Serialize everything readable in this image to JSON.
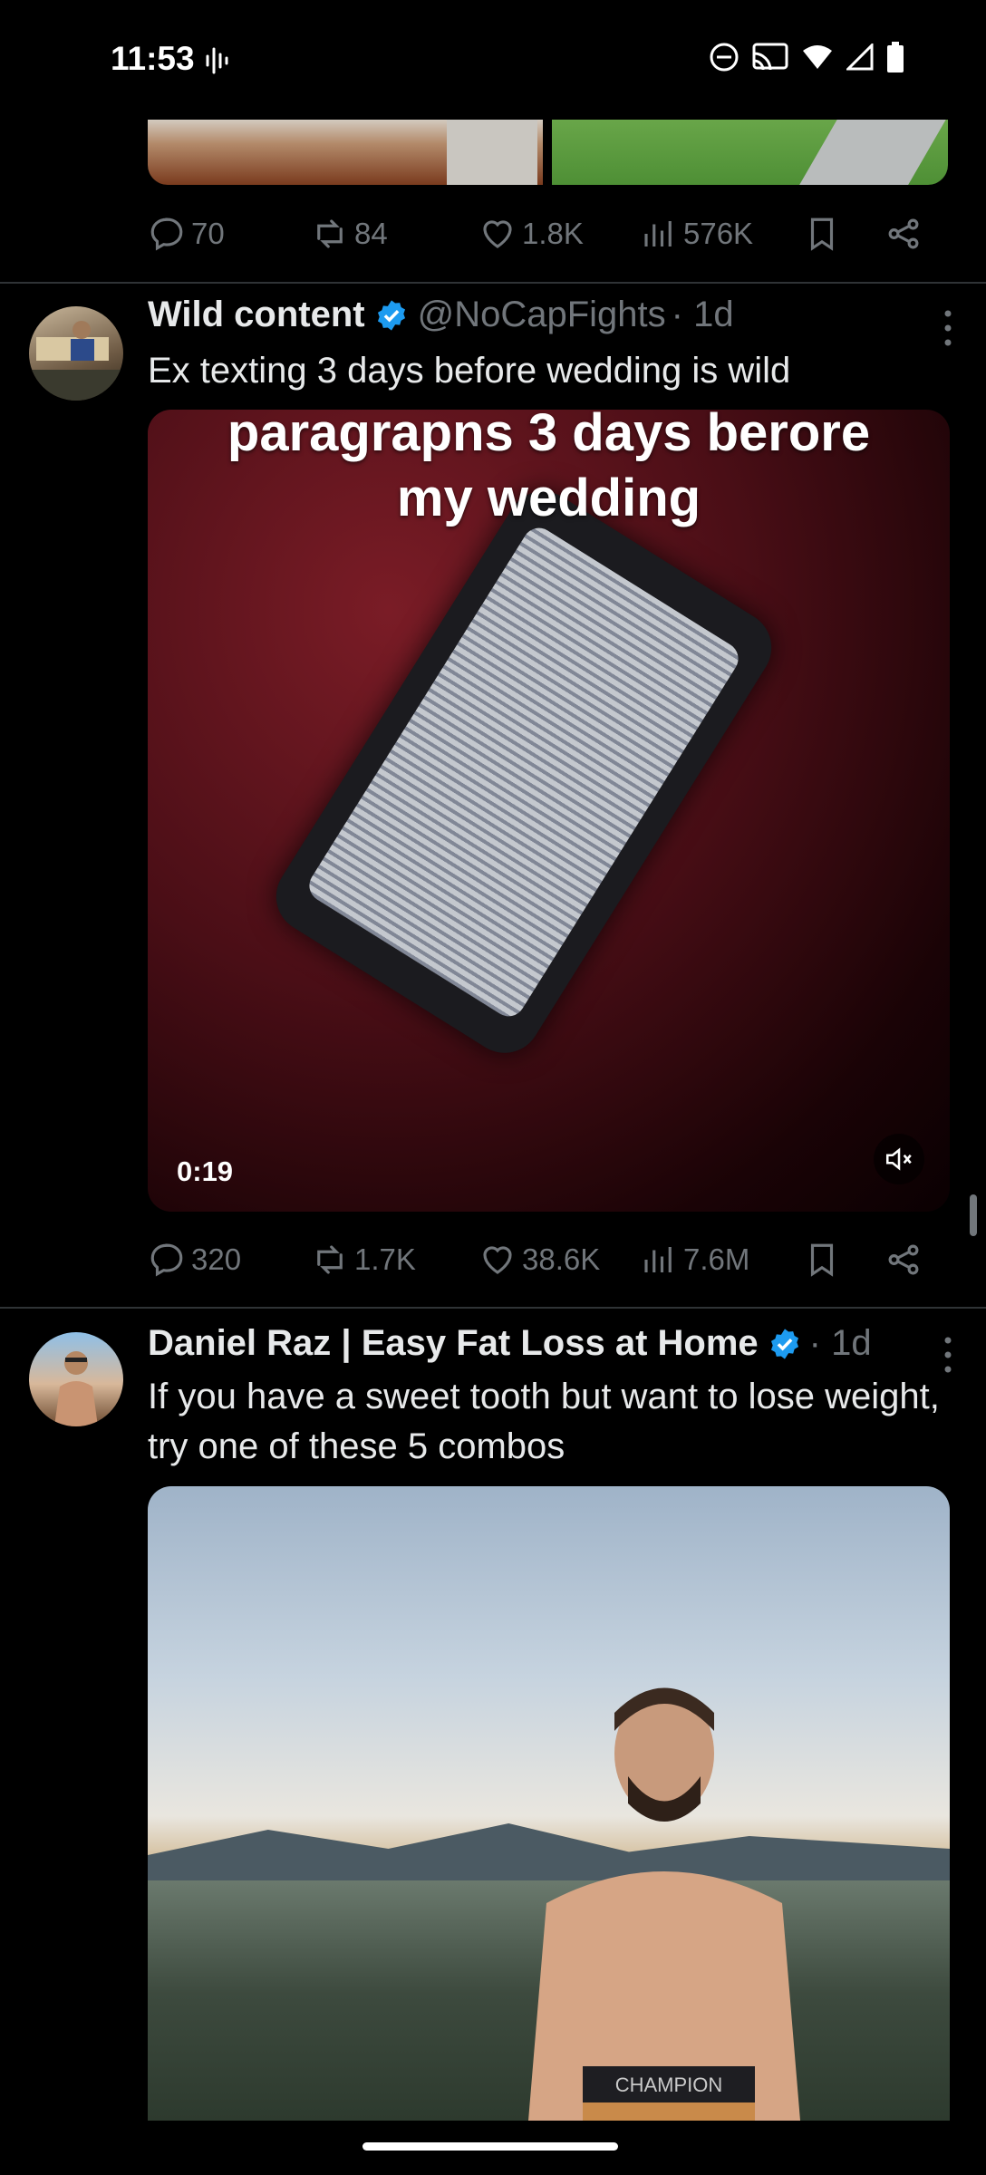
{
  "status_bar": {
    "time": "11:53"
  },
  "prev_tweet": {
    "actions": {
      "replies": "70",
      "retweets": "84",
      "likes": "1.8K",
      "views": "576K"
    }
  },
  "tweet1": {
    "author": "Wild content",
    "handle": "@NoCapFights",
    "time": "· 1d",
    "text": "Ex texting 3 days before wedding is wild",
    "video": {
      "caption_line1": "paragrapns 3 days berore",
      "caption_line2": "my wedding",
      "duration": "0:19"
    },
    "actions": {
      "replies": "320",
      "retweets": "1.7K",
      "likes": "38.6K",
      "views": "7.6M"
    }
  },
  "tweet2": {
    "author": "Daniel Raz | Easy Fat Loss at Home",
    "time": "· 1d",
    "text": "If you have a sweet tooth but want to lose weight, try one of these 5 combos",
    "photo_text": "CHAMPION"
  },
  "colors": {
    "background": "#000000",
    "muted": "#71767b",
    "verified": "#1d9bf0",
    "text": "#e7e9ea"
  }
}
